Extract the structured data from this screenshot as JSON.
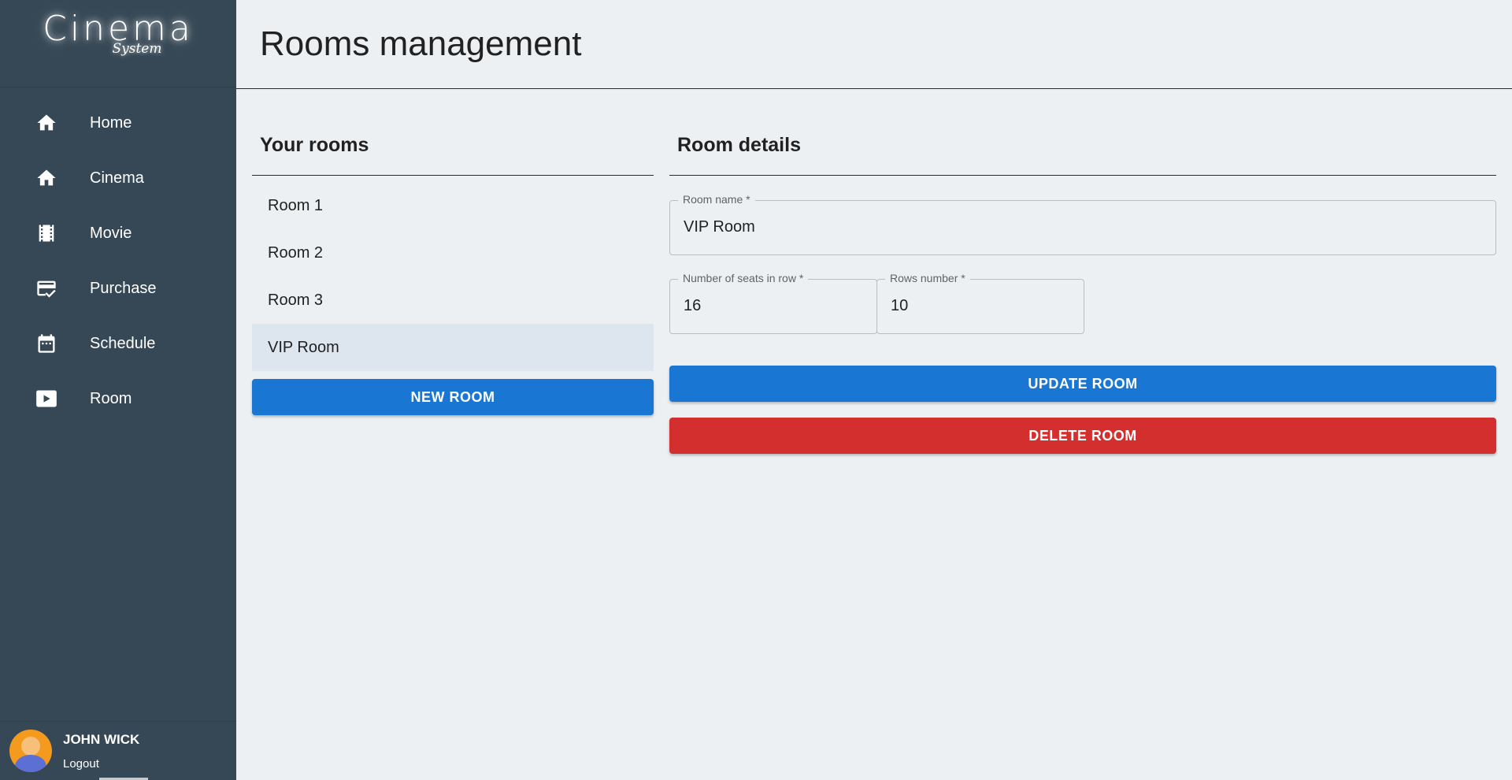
{
  "sidebar": {
    "logo_title": "Cinema",
    "logo_subtitle": "System",
    "items": [
      {
        "label": "Home",
        "icon": "home-icon"
      },
      {
        "label": "Cinema",
        "icon": "home-icon"
      },
      {
        "label": "Movie",
        "icon": "film-icon"
      },
      {
        "label": "Purchase",
        "icon": "credit-card-check-icon"
      },
      {
        "label": "Schedule",
        "icon": "calendar-icon"
      },
      {
        "label": "Room",
        "icon": "play-box-icon"
      }
    ],
    "user": {
      "name": "JOHN WICK",
      "logout_label": "Logout"
    }
  },
  "header": {
    "title": "Rooms management"
  },
  "rooms_panel": {
    "title": "Your rooms",
    "rooms": [
      "Room 1",
      "Room 2",
      "Room 3",
      "VIP Room"
    ],
    "selected": "VIP Room",
    "new_room_label": "NEW ROOM"
  },
  "details_panel": {
    "title": "Room details",
    "room_name": {
      "label": "Room name *",
      "value": "VIP Room"
    },
    "seats_in_row": {
      "label": "Number of seats in row *",
      "value": "16"
    },
    "rows_number": {
      "label": "Rows number *",
      "value": "10"
    },
    "update_label": "UPDATE ROOM",
    "delete_label": "DELETE ROOM"
  },
  "colors": {
    "sidebar_bg": "#364855",
    "page_bg": "#edf0f3",
    "primary": "#1976d2",
    "danger": "#d32f2f",
    "selected_row": "#dde6ee"
  }
}
